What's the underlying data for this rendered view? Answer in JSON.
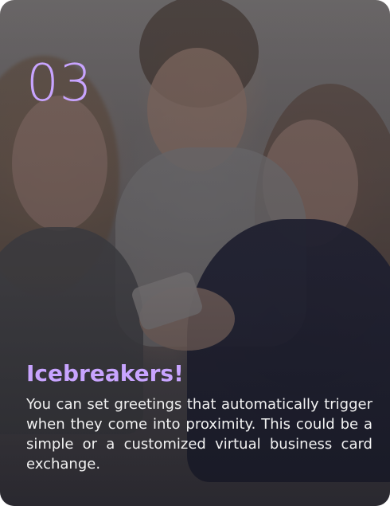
{
  "card": {
    "step_number": "03",
    "title": "Icebreakers!",
    "description": "You can set greetings that automatically trigger when they come into proximity. This could be a simple or a customized virtual business card exchange.",
    "accent_color": "#c8a4ff",
    "text_color": "#f2f2f2"
  }
}
